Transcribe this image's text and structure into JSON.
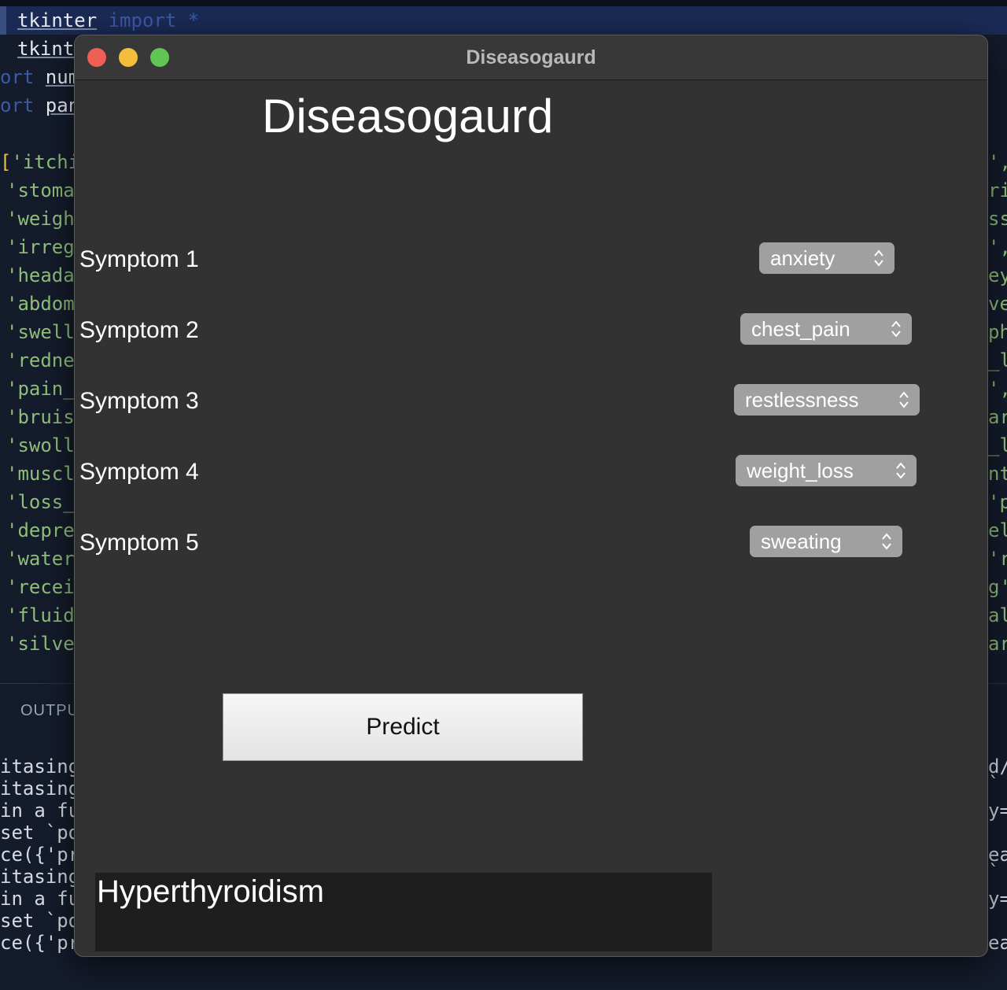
{
  "editor": {
    "line1": {
      "a": "tkinter",
      "b": " import ",
      "c": "*"
    },
    "line2": "tkint",
    "line3": {
      "a": "ort ",
      "b": "num"
    },
    "line4": {
      "a": "ort ",
      "b": "pan"
    },
    "code_lines": [
      "'itchi",
      "'stoma",
      "'weigh",
      "'irreg",
      "'heada",
      "'abdom",
      "'swell",
      "'redne",
      "'pain_",
      "'bruis",
      "'swoll",
      "'muscl",
      "'loss_",
      "'depre",
      "'water",
      "'recei",
      "'fluid",
      "'silve"
    ],
    "right_fragments": [
      "',",
      "ri",
      "ss",
      "','",
      "ey",
      "ve",
      "ph",
      "_l",
      "',",
      "ar",
      "_l",
      "nt",
      "'p",
      "el",
      "'r",
      "g'",
      "al",
      "ar"
    ],
    "output_title": "OUTPU",
    "output_lines": [
      "itasing",
      "itasing",
      "in a fu",
      "set `pd",
      "ce({'pr",
      "itasing",
      "in a fu",
      "set `pd",
      "ce({'pr"
    ],
    "output_right": [
      "d/",
      "`",
      "y=",
      "",
      "ea",
      "`",
      "y=",
      "",
      "ea"
    ]
  },
  "window": {
    "title": "Diseasogaurd",
    "heading": "Diseasogaurd",
    "symptoms": [
      {
        "label": "Symptom 1",
        "value": "anxiety"
      },
      {
        "label": "Symptom 2",
        "value": "chest_pain"
      },
      {
        "label": "Symptom 3",
        "value": "restlessness"
      },
      {
        "label": "Symptom 4",
        "value": "weight_loss"
      },
      {
        "label": "Symptom 5",
        "value": "sweating"
      }
    ],
    "predict_label": "Predict",
    "result": "Hyperthyroidism"
  },
  "colors": {
    "window_bg": "#323232",
    "dropdown_bg": "#a0a0a0",
    "close": "#ee5f56",
    "minimize": "#f4bd3b",
    "zoom": "#61c554"
  }
}
